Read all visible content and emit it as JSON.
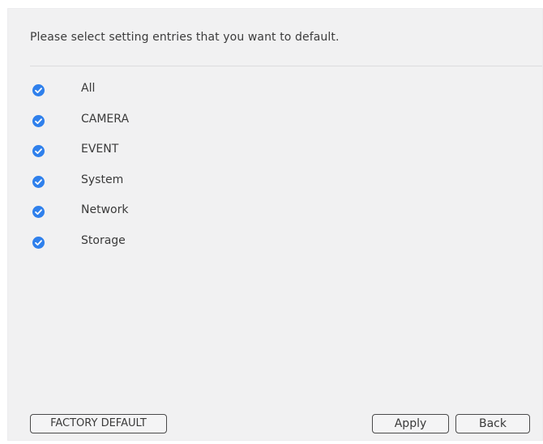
{
  "dialog": {
    "instruction": "Please select setting entries that you want to default."
  },
  "entries": [
    {
      "label": "All",
      "checked": true,
      "icon": "check-circle-icon"
    },
    {
      "label": "CAMERA",
      "checked": true,
      "icon": "check-circle-icon"
    },
    {
      "label": "EVENT",
      "checked": true,
      "icon": "check-circle-icon"
    },
    {
      "label": "System",
      "checked": true,
      "icon": "check-circle-icon"
    },
    {
      "label": "Network",
      "checked": true,
      "icon": "check-circle-icon"
    },
    {
      "label": "Storage",
      "checked": true,
      "icon": "check-circle-icon"
    }
  ],
  "buttons": {
    "factory_default": "FACTORY DEFAULT",
    "apply": "Apply",
    "back": "Back"
  },
  "colors": {
    "accent": "#2f80ec",
    "panel_background": "#f1f1f2",
    "text": "#3a3a3a"
  }
}
